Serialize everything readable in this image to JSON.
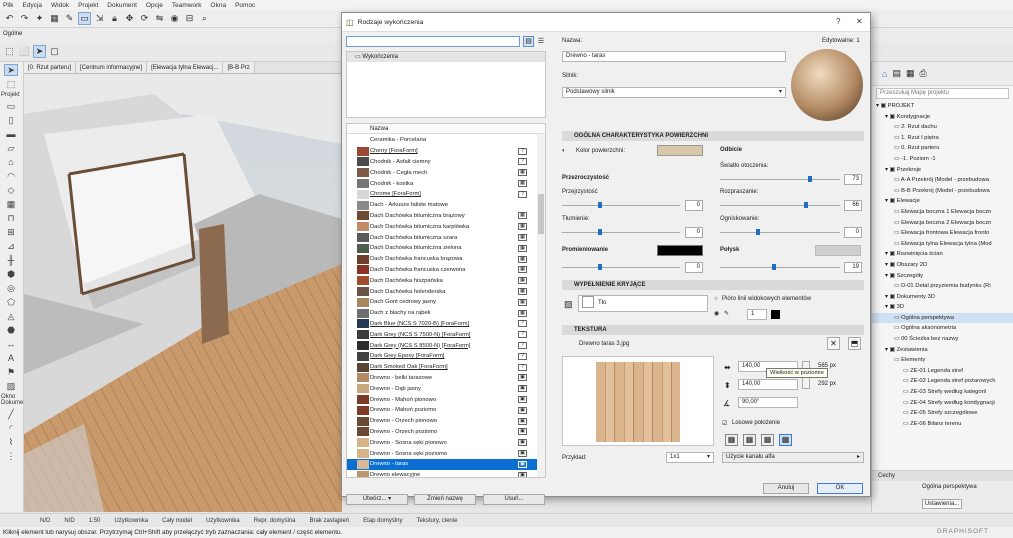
{
  "menubar": [
    "Plik",
    "Edycja",
    "Widok",
    "Projekt",
    "Dokument",
    "Opcje",
    "Teamwork",
    "Okna",
    "Pomoc"
  ],
  "toolbar_label": "Ogólne",
  "toolbox": {
    "label_top": "Projekt",
    "label_okno": "Okno",
    "label_dokume": "Dokume"
  },
  "view_tabs": [
    "[0. Rzut parteru]",
    "[Centrum informacyjne]",
    "[Elewacja tylna Elewacj...",
    "[B-B Prz"
  ],
  "dialog": {
    "title": "Rodzaje wykończenia",
    "help": "?",
    "close": "✕",
    "top_item": "Wykończenia",
    "list_header": "Nazwa",
    "items": [
      {
        "name": "Ceramika - Porcelana",
        "color": "#ffffff",
        "ul": false,
        "icon": ""
      },
      {
        "name": "Cherry [ForaForm]",
        "color": "#9a4a34",
        "ul": true,
        "icon": "?"
      },
      {
        "name": "Chodnik - Asfalt ciemny",
        "color": "#4b4b4b",
        "ul": false,
        "icon": "?"
      },
      {
        "name": "Chodnik - Cegła mech",
        "color": "#7d5a45",
        "ul": false,
        "icon": "▦"
      },
      {
        "name": "Chodnik - kostka",
        "color": "#777777",
        "ul": false,
        "icon": "▦"
      },
      {
        "name": "Chrome [ForaForm]",
        "color": "#d7d7d7",
        "ul": true,
        "icon": "?"
      },
      {
        "name": "Dach - Arkusze faliste matowe",
        "color": "#8a8a8a",
        "ul": false,
        "icon": ""
      },
      {
        "name": "Dach Dachówka bitumiczna brązowy",
        "color": "#6e4a34",
        "ul": false,
        "icon": "▦"
      },
      {
        "name": "Dach Dachówka bitumiczna karpiówka",
        "color": "#c28a66",
        "ul": false,
        "icon": "▦"
      },
      {
        "name": "Dach Dachówka bitumiczna szara",
        "color": "#5a5a5a",
        "ul": false,
        "icon": "▦"
      },
      {
        "name": "Dach Dachówka bitumiczna zielona",
        "color": "#4e5e4c",
        "ul": false,
        "icon": "▦"
      },
      {
        "name": "Dach Dachówka francuska brązowa",
        "color": "#6b3f2a",
        "ul": false,
        "icon": "▦"
      },
      {
        "name": "Dach Dachówka francuska czerwona",
        "color": "#8b3224",
        "ul": false,
        "icon": "▦"
      },
      {
        "name": "Dach Dachówka hiszpańska",
        "color": "#a14d2c",
        "ul": false,
        "icon": "▦"
      },
      {
        "name": "Dach Dachówka holenderska",
        "color": "#6a5248",
        "ul": false,
        "icon": "▦"
      },
      {
        "name": "Dach Gont cedrowy jasny",
        "color": "#a8865f",
        "ul": false,
        "icon": "▦"
      },
      {
        "name": "Dach z blachy na rąbek",
        "color": "#6e6e6e",
        "ul": false,
        "icon": "▦"
      },
      {
        "name": "Dark Blue (NCS S 7020-B) [ForaForm]",
        "color": "#243a52",
        "ul": true,
        "icon": "?"
      },
      {
        "name": "Dark Grey (NCS S 7500-N) [ForaForm]",
        "color": "#3c3c3c",
        "ul": true,
        "icon": "?"
      },
      {
        "name": "Dark Grey (NCS S 8500-N) [ForaForm]",
        "color": "#2d2d2d",
        "ul": true,
        "icon": "?"
      },
      {
        "name": "Dark Grey Epoxy [ForaForm]",
        "color": "#404040",
        "ul": true,
        "icon": "?"
      },
      {
        "name": "Dark Smoked Oak [ForaForm]",
        "color": "#5a4332",
        "ul": true,
        "icon": "?"
      },
      {
        "name": "Drewno - belki tarasowe",
        "color": "#b38a66",
        "ul": false,
        "icon": "▣"
      },
      {
        "name": "Drewno - Dąb jasny",
        "color": "#c9a87c",
        "ul": false,
        "icon": "▣"
      },
      {
        "name": "Drewno - Mahoń pionowo",
        "color": "#7b3b26",
        "ul": false,
        "icon": "▣"
      },
      {
        "name": "Drewno - Mahoń poziomo",
        "color": "#7b3b26",
        "ul": false,
        "icon": "▣"
      },
      {
        "name": "Drewno - Orzech pionowo",
        "color": "#6a4a33",
        "ul": false,
        "icon": "▣"
      },
      {
        "name": "Drewno - Orzech poziomo",
        "color": "#6a4a33",
        "ul": false,
        "icon": "▣"
      },
      {
        "name": "Drewno - Sosna sęki pionowo",
        "color": "#d6b488",
        "ul": false,
        "icon": "▣"
      },
      {
        "name": "Drewno - Sosna sęki poziomo",
        "color": "#d6b488",
        "ul": false,
        "icon": "▣"
      },
      {
        "name": "Drewno - taras",
        "color": "#d9b999",
        "ul": false,
        "icon": "▣",
        "selected": true
      },
      {
        "name": "Drewno elewacyjne",
        "color": "#b99670",
        "ul": false,
        "icon": "▣"
      }
    ],
    "buttons": {
      "create": "Utwórz...",
      "rename": "Zmień nazwę",
      "delete": "Usuń..."
    },
    "name_label": "Nazwa:",
    "editable_label": "Edytowalne: 1",
    "name_value": "Drewno - taras",
    "engine_label": "Silnik:",
    "engine_value": "Podstawowy silnik",
    "sec_general": "OGÓLNA CHARAKTERYSTYKA POWIERZCHNI",
    "surface_color_label": "Kolor powierzchni:",
    "surface_color": "#d8c7a8",
    "reflection_label": "Odbicie",
    "ambient_label": "Światło otoczenia:",
    "ambient_value": "73",
    "transparency_label": "Przezroczystość",
    "transparency_sub": "Przejrzystość",
    "transparency_value": "0",
    "diffusion_label": "Rozpraszanie:",
    "diffusion_value": "66",
    "damping_label": "Tłumienie:",
    "damping_value": "0",
    "focus_label": "Ogniskowanie:",
    "focus_value": "0",
    "glow_label": "Promieniowanie",
    "glow_value": "0",
    "shine_label": "Połysk",
    "shine_value": "19",
    "sec_fill": "WYPEŁNIENIE KRYJĄCE",
    "fill_value": "Tło",
    "pen_label": "Pióro linii widokowych elementów",
    "pen_value": "1",
    "sec_texture": "TEKSTURA",
    "texture_name": "Drewno taras 3.jpg",
    "width_value": "140,00",
    "width_px": "565 px",
    "height_value": "140,00",
    "height_px": "292 px",
    "angle_value": "90,00°",
    "tooltip": "Wielkość w poziomie",
    "random_label": "Losowe położenie",
    "example_label": "Przykład:",
    "example_value": "1x1",
    "alpha_value": "Użycie kanału alfa",
    "cancel": "Anuluj",
    "ok": "OK"
  },
  "navigator": {
    "search_placeholder": "Przeszukaj Mapę projektu",
    "items": [
      {
        "t": "PROJEKT",
        "l": 0
      },
      {
        "t": "Kondygnacje",
        "l": 1
      },
      {
        "t": "2. Rzut dachu",
        "l": 2
      },
      {
        "t": "1. Rzut I piętra",
        "l": 2
      },
      {
        "t": "0. Rzut parteru",
        "l": 2
      },
      {
        "t": "-1. Poziom -1",
        "l": 2
      },
      {
        "t": "Przekroje",
        "l": 1
      },
      {
        "t": "A-A Przekrój (Model - przebudowa",
        "l": 2
      },
      {
        "t": "B-B Przekrój (Model - przebudowa",
        "l": 2
      },
      {
        "t": "Elewacje",
        "l": 1
      },
      {
        "t": "Elewacja boczna 1 Elewacja boczn",
        "l": 2
      },
      {
        "t": "Elewacja boczna 2 Elewacja boczn",
        "l": 2
      },
      {
        "t": "Elewacja frontowa Elewacja fronto",
        "l": 2
      },
      {
        "t": "Elewacja tylna Elewacja tylna (Mod",
        "l": 2
      },
      {
        "t": "Rozwinięcia ścian",
        "l": 1
      },
      {
        "t": "Obszary 2D",
        "l": 1
      },
      {
        "t": "Szczegóły",
        "l": 1
      },
      {
        "t": "D-01 Detal przyziemia budynku (Ri",
        "l": 2
      },
      {
        "t": "Dokumenty 3D",
        "l": 1
      },
      {
        "t": "3D",
        "l": 1
      },
      {
        "t": "Ogólna perspektywa",
        "l": 2,
        "sel": true
      },
      {
        "t": "Ogólna aksonometria",
        "l": 2
      },
      {
        "t": "00 Ścieżka bez nazwy",
        "l": 2
      },
      {
        "t": "Zestawienia",
        "l": 1
      },
      {
        "t": "Elementy",
        "l": 2
      },
      {
        "t": "ZE-01 Legenda stref",
        "l": 3
      },
      {
        "t": "ZE-02 Legenda stref pożarowych",
        "l": 3
      },
      {
        "t": "ZE-03 Strefy według kategorii",
        "l": 3
      },
      {
        "t": "ZE-04 Strefy według kondygnacji",
        "l": 3
      },
      {
        "t": "ZE-05 Strefy szczegółowe",
        "l": 3
      },
      {
        "t": "ZE-06 Bilans terenu",
        "l": 3
      }
    ],
    "props_label": "Cechy",
    "props_value": "Ogólna perspektywa",
    "settings": "Ustawienia..."
  },
  "statusbar": [
    "N/D",
    "N/D",
    "1:50",
    "Użytkownika",
    "Cały model",
    "Użytkownika",
    "Repr. domyślna",
    "Brak zastąpień",
    "Etap domyślny",
    "Tekstury, cienie"
  ],
  "infobar": "Kliknij element lub narysuj obszar. Przytrzymaj Ctrl+Shift aby przełączyć tryb zaznaczania: cały element / część elementu.",
  "brand": "GRAPHISOFT"
}
